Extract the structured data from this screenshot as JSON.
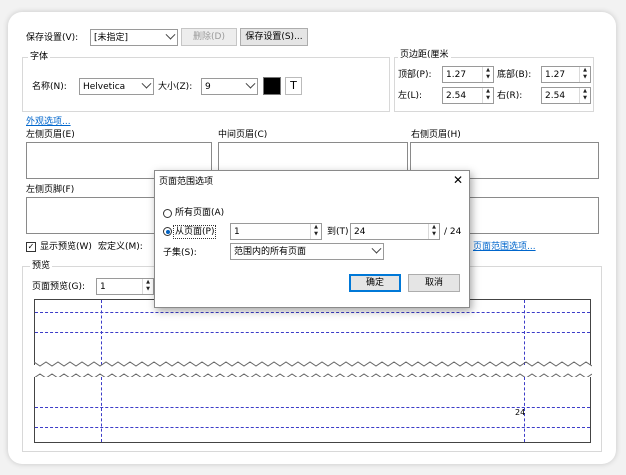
{
  "toolbar": {
    "save_settings_label": "保存设置(V):",
    "save_settings_value": "[未指定]",
    "delete_label": "删除(D)",
    "save_button_label": "保存设置(S)..."
  },
  "font": {
    "group_label": "字体",
    "name_label": "名称(N):",
    "name_value": "Helvetica",
    "size_label": "大小(Z):",
    "size_value": "9",
    "color": "#000000",
    "text_icon": "T"
  },
  "margins": {
    "group_label": "页边距(厘米",
    "top_label": "顶部(P):",
    "top_value": "1.27",
    "bottom_label": "底部(B):",
    "bottom_value": "1.27",
    "left_label": "左(L):",
    "left_value": "2.54",
    "right_label": "右(R):",
    "right_value": "2.54"
  },
  "appearance_link": "外观选项...",
  "header": {
    "left_label": "左侧页眉(E)",
    "center_label": "中间页眉(C)",
    "right_label": "右侧页眉(H)"
  },
  "footer": {
    "left_label": "左侧页脚(F)"
  },
  "options": {
    "show_preview_label": "显示预览(W)",
    "macro_label": "宏定义(M):",
    "page_range_link": "页面范围选项..."
  },
  "preview": {
    "group_label": "预览",
    "page_preview_label": "页面预览(G):",
    "page_preview_value": "1",
    "page_number": "24"
  },
  "dialog": {
    "title": "页面范围选项",
    "all_pages_label": "所有页面(A)",
    "from_page_label": "从页面(P)",
    "from_value": "1",
    "to_label": "到(T)",
    "to_value": "24",
    "total": "/ 24",
    "subset_label": "子集(S):",
    "subset_value": "范围内的所有页面",
    "ok_label": "确定",
    "cancel_label": "取消"
  }
}
